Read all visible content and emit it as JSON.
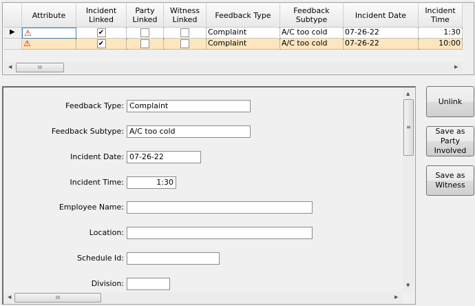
{
  "grid": {
    "columns": [
      "Attribute",
      "Incident Linked",
      "Party Linked",
      "Witness Linked",
      "Feedback Type",
      "Feedback Subtype",
      "Incident Date",
      "Incident Time"
    ],
    "rows": [
      {
        "attribute_icon": "warning-icon",
        "incident_linked": true,
        "party_linked": false,
        "witness_linked": false,
        "feedback_type": "Complaint",
        "feedback_subtype": "A/C too cold",
        "incident_date": "07-26-22",
        "incident_time": "1:30",
        "current": true,
        "selected": false
      },
      {
        "attribute_icon": "warning-icon",
        "incident_linked": true,
        "party_linked": false,
        "witness_linked": false,
        "feedback_type": "Complaint",
        "feedback_subtype": "A/C too cold",
        "incident_date": "07-26-22",
        "incident_time": "10:00",
        "current": false,
        "selected": true
      }
    ],
    "selected_row_color": "#fde5bd"
  },
  "form": {
    "feedback_type": {
      "label": "Feedback Type:",
      "value": "Complaint"
    },
    "feedback_subtype": {
      "label": "Feedback Subtype:",
      "value": "A/C too cold"
    },
    "incident_date": {
      "label": "Incident Date:",
      "value": "07-26-22"
    },
    "incident_time": {
      "label": "Incident Time:",
      "value": "1:30"
    },
    "employee_name": {
      "label": "Employee Name:",
      "value": ""
    },
    "location": {
      "label": "Location:",
      "value": ""
    },
    "schedule_id": {
      "label": "Schedule Id:",
      "value": ""
    },
    "division": {
      "label": "Division:",
      "value": ""
    }
  },
  "buttons": {
    "unlink": "Unlink",
    "save_party": "Save as Party Involved",
    "save_witness": "Save as Witness"
  },
  "scroll_grip": "III"
}
